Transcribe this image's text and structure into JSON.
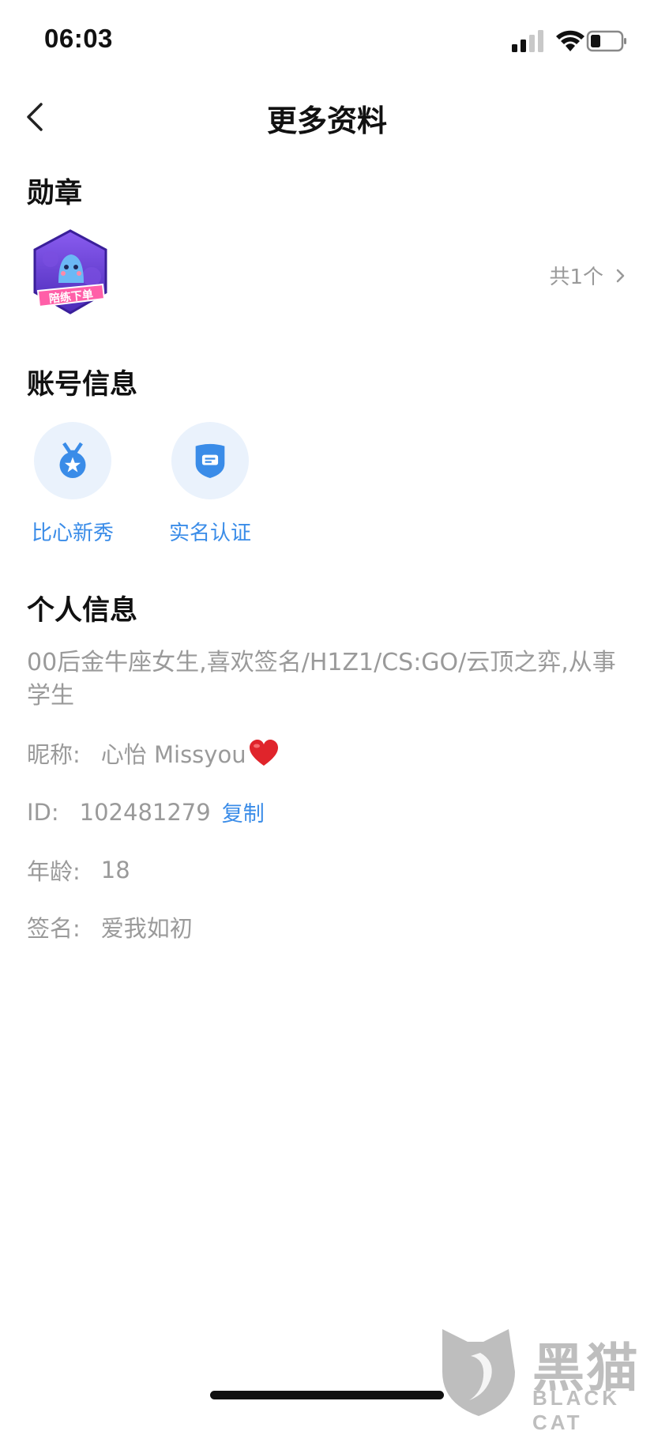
{
  "status_bar": {
    "time": "06:03",
    "icons": [
      "cellular-signal-icon",
      "wifi-icon",
      "battery-icon"
    ]
  },
  "nav": {
    "back_icon": "chevron-left-icon",
    "title": "更多资料"
  },
  "badges": {
    "title": "勋章",
    "medal_label": "陪练下单",
    "count_label": "共1个",
    "chevron_icon": "chevron-right-icon"
  },
  "account_info": {
    "title": "账号信息",
    "items": [
      {
        "label": "比心新秀",
        "icon": "star-medal-icon"
      },
      {
        "label": "实名认证",
        "icon": "shield-id-icon"
      }
    ]
  },
  "personal_info": {
    "title": "个人信息",
    "bio": "00后金牛座女生,喜欢签名/H1Z1/CS:GO/云顶之弈,从事学生",
    "nickname_label": "昵称:",
    "nickname_value": "心怡 Missyou",
    "id_label": "ID:",
    "id_value": "102481279",
    "copy_label": "复制",
    "age_label": "年龄:",
    "age_value": "18",
    "signature_label": "签名:",
    "signature_value": "爱我如初"
  },
  "watermark": {
    "text": "黑猫",
    "subtext": "BLACK CAT"
  },
  "colors": {
    "accent_blue": "#3a8ce8",
    "muted_text": "#9a9a9a",
    "icon_bg": "#eaf2fc",
    "medal_purple": "#6a3fd8",
    "heart_red": "#e0242b"
  }
}
